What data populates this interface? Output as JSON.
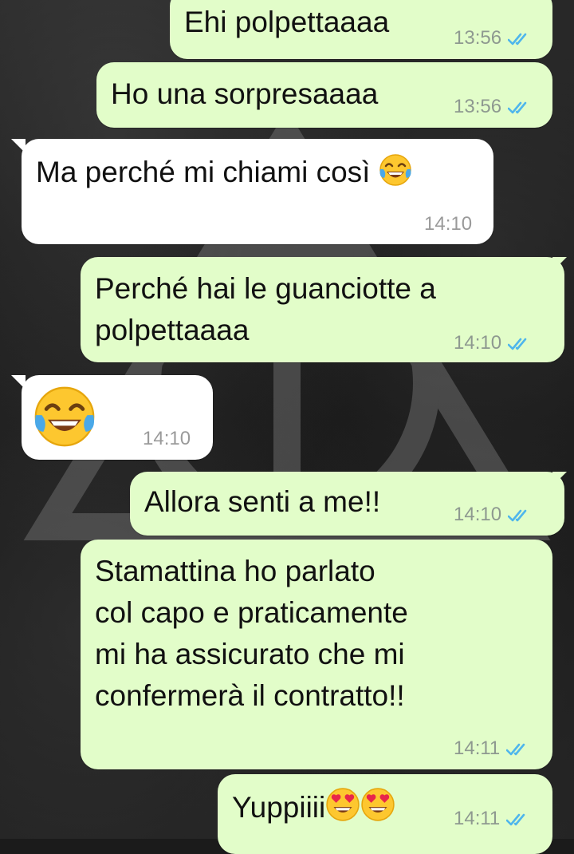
{
  "colors": {
    "outgoing_bubble": "#e2fdc9",
    "incoming_bubble": "#ffffff",
    "read_ticks": "#4fb6ec",
    "time_text": "#8e9990"
  },
  "messages": [
    {
      "direction": "outgoing",
      "text": "Ehi polpettaaaa",
      "time": "13:56",
      "status_icon": "double-check-read-icon"
    },
    {
      "direction": "outgoing",
      "text": "Ho una sorpresaaaa",
      "time": "13:56",
      "status_icon": "double-check-read-icon"
    },
    {
      "direction": "incoming",
      "text": "Ma perché mi chiami così",
      "emoji": "face-with-tears-of-joy",
      "time": "14:10"
    },
    {
      "direction": "outgoing",
      "lines": [
        "Perché hai le guanciotte a",
        "polpettaaaa"
      ],
      "time": "14:10",
      "status_icon": "double-check-read-icon"
    },
    {
      "direction": "incoming",
      "emoji": "face-with-tears-of-joy",
      "time": "14:10"
    },
    {
      "direction": "outgoing",
      "text": "Allora senti a me!!",
      "time": "14:10",
      "status_icon": "double-check-read-icon"
    },
    {
      "direction": "outgoing",
      "lines": [
        "Stamattina ho parlato",
        "col capo e praticamente",
        "mi ha assicurato che mi",
        "confermerà il contratto!!"
      ],
      "time": "14:11",
      "status_icon": "double-check-read-icon"
    },
    {
      "direction": "outgoing",
      "text": "Yuppiiii",
      "emoji": "smiling-face-with-heart-eyes",
      "emoji_count": 2,
      "time": "14:11",
      "status_icon": "double-check-read-icon"
    }
  ]
}
